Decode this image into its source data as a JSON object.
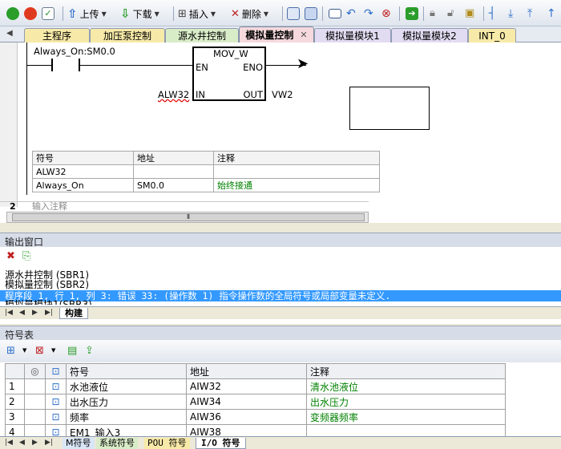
{
  "toolbar": {
    "upload_label": "上传",
    "download_label": "下载",
    "insert_label": "插入",
    "delete_label": "删除"
  },
  "tabs": [
    {
      "label": "主程序"
    },
    {
      "label": "加压泵控制"
    },
    {
      "label": "源水井控制"
    },
    {
      "label": "模拟量控制"
    },
    {
      "label": "模拟量模块1"
    },
    {
      "label": "模拟量模块2"
    },
    {
      "label": "INT_0"
    }
  ],
  "ladder": {
    "contact_label": "Always_On:SM0.0",
    "box_title": "MOV_W",
    "en_pin": "EN",
    "eno_pin": "ENO",
    "in_pin": "IN",
    "out_pin": "OUT",
    "in_operand": "ALW32",
    "out_operand": "VW2"
  },
  "local_symbols": {
    "headers": [
      "符号",
      "地址",
      "注释"
    ],
    "rows": [
      {
        "symbol": "ALW32",
        "address": "",
        "comment": ""
      },
      {
        "symbol": "Always_On",
        "address": "SM0.0",
        "comment": "始终接通"
      }
    ]
  },
  "network": {
    "number": "2",
    "placeholder": "输入注释"
  },
  "output_window": {
    "title": "输出窗口",
    "lines": [
      "源水井控制 (SBR1)",
      "模拟量控制 (SBR2)",
      "模拟量模块1(SBR3)"
    ],
    "error_line": "程序段 1, 行 1, 列 3: 错误 33: (操作数 1) 指令操作数的全局符号或局部变量未定义.",
    "tab_label": "构建"
  },
  "symbol_table": {
    "title": "符号表",
    "headers": [
      "符号",
      "地址",
      "注释"
    ],
    "rows": [
      {
        "num": "1",
        "symbol": "水池液位",
        "address": "AIW32",
        "comment": "清水池液位"
      },
      {
        "num": "2",
        "symbol": "出水压力",
        "address": "AIW34",
        "comment": "出水压力"
      },
      {
        "num": "3",
        "symbol": "频率",
        "address": "AIW36",
        "comment": "变频器频率"
      },
      {
        "num": "4",
        "symbol": "EM1_输入3",
        "address": "AIW38",
        "comment": ""
      }
    ],
    "tabs": [
      {
        "label": "M符号"
      },
      {
        "label": "系统符号"
      },
      {
        "label": "POU 符号"
      },
      {
        "label": "I/O 符号"
      }
    ]
  },
  "colors": {
    "active_tab": "#f5d9dc",
    "tab_yellow": "#f7e9a8",
    "tab_green": "#d9ecc8",
    "tab_purple": "#e2dcf2",
    "selection": "#3399ff",
    "comment_green": "#008000"
  }
}
